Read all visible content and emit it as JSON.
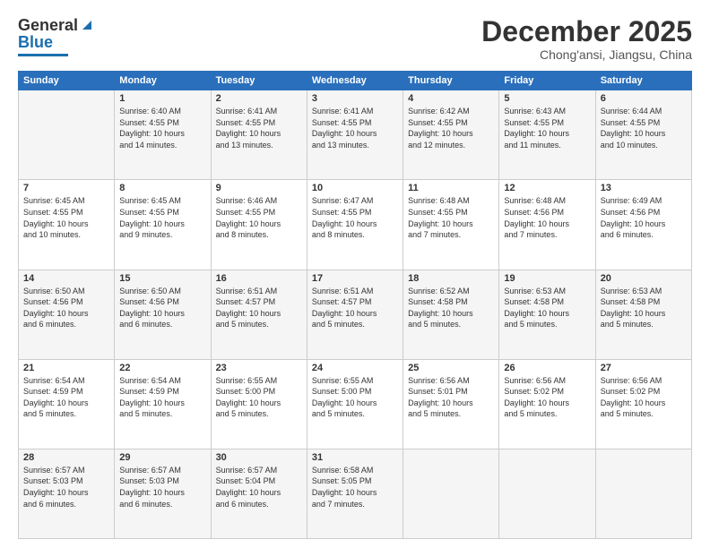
{
  "logo": {
    "line1": "General",
    "line2": "Blue"
  },
  "header": {
    "title": "December 2025",
    "subtitle": "Chong'ansi, Jiangsu, China"
  },
  "weekdays": [
    "Sunday",
    "Monday",
    "Tuesday",
    "Wednesday",
    "Thursday",
    "Friday",
    "Saturday"
  ],
  "weeks": [
    [
      {
        "day": "",
        "info": ""
      },
      {
        "day": "1",
        "info": "Sunrise: 6:40 AM\nSunset: 4:55 PM\nDaylight: 10 hours\nand 14 minutes."
      },
      {
        "day": "2",
        "info": "Sunrise: 6:41 AM\nSunset: 4:55 PM\nDaylight: 10 hours\nand 13 minutes."
      },
      {
        "day": "3",
        "info": "Sunrise: 6:41 AM\nSunset: 4:55 PM\nDaylight: 10 hours\nand 13 minutes."
      },
      {
        "day": "4",
        "info": "Sunrise: 6:42 AM\nSunset: 4:55 PM\nDaylight: 10 hours\nand 12 minutes."
      },
      {
        "day": "5",
        "info": "Sunrise: 6:43 AM\nSunset: 4:55 PM\nDaylight: 10 hours\nand 11 minutes."
      },
      {
        "day": "6",
        "info": "Sunrise: 6:44 AM\nSunset: 4:55 PM\nDaylight: 10 hours\nand 10 minutes."
      }
    ],
    [
      {
        "day": "7",
        "info": "Sunrise: 6:45 AM\nSunset: 4:55 PM\nDaylight: 10 hours\nand 10 minutes."
      },
      {
        "day": "8",
        "info": "Sunrise: 6:45 AM\nSunset: 4:55 PM\nDaylight: 10 hours\nand 9 minutes."
      },
      {
        "day": "9",
        "info": "Sunrise: 6:46 AM\nSunset: 4:55 PM\nDaylight: 10 hours\nand 8 minutes."
      },
      {
        "day": "10",
        "info": "Sunrise: 6:47 AM\nSunset: 4:55 PM\nDaylight: 10 hours\nand 8 minutes."
      },
      {
        "day": "11",
        "info": "Sunrise: 6:48 AM\nSunset: 4:55 PM\nDaylight: 10 hours\nand 7 minutes."
      },
      {
        "day": "12",
        "info": "Sunrise: 6:48 AM\nSunset: 4:56 PM\nDaylight: 10 hours\nand 7 minutes."
      },
      {
        "day": "13",
        "info": "Sunrise: 6:49 AM\nSunset: 4:56 PM\nDaylight: 10 hours\nand 6 minutes."
      }
    ],
    [
      {
        "day": "14",
        "info": "Sunrise: 6:50 AM\nSunset: 4:56 PM\nDaylight: 10 hours\nand 6 minutes."
      },
      {
        "day": "15",
        "info": "Sunrise: 6:50 AM\nSunset: 4:56 PM\nDaylight: 10 hours\nand 6 minutes."
      },
      {
        "day": "16",
        "info": "Sunrise: 6:51 AM\nSunset: 4:57 PM\nDaylight: 10 hours\nand 5 minutes."
      },
      {
        "day": "17",
        "info": "Sunrise: 6:51 AM\nSunset: 4:57 PM\nDaylight: 10 hours\nand 5 minutes."
      },
      {
        "day": "18",
        "info": "Sunrise: 6:52 AM\nSunset: 4:58 PM\nDaylight: 10 hours\nand 5 minutes."
      },
      {
        "day": "19",
        "info": "Sunrise: 6:53 AM\nSunset: 4:58 PM\nDaylight: 10 hours\nand 5 minutes."
      },
      {
        "day": "20",
        "info": "Sunrise: 6:53 AM\nSunset: 4:58 PM\nDaylight: 10 hours\nand 5 minutes."
      }
    ],
    [
      {
        "day": "21",
        "info": "Sunrise: 6:54 AM\nSunset: 4:59 PM\nDaylight: 10 hours\nand 5 minutes."
      },
      {
        "day": "22",
        "info": "Sunrise: 6:54 AM\nSunset: 4:59 PM\nDaylight: 10 hours\nand 5 minutes."
      },
      {
        "day": "23",
        "info": "Sunrise: 6:55 AM\nSunset: 5:00 PM\nDaylight: 10 hours\nand 5 minutes."
      },
      {
        "day": "24",
        "info": "Sunrise: 6:55 AM\nSunset: 5:00 PM\nDaylight: 10 hours\nand 5 minutes."
      },
      {
        "day": "25",
        "info": "Sunrise: 6:56 AM\nSunset: 5:01 PM\nDaylight: 10 hours\nand 5 minutes."
      },
      {
        "day": "26",
        "info": "Sunrise: 6:56 AM\nSunset: 5:02 PM\nDaylight: 10 hours\nand 5 minutes."
      },
      {
        "day": "27",
        "info": "Sunrise: 6:56 AM\nSunset: 5:02 PM\nDaylight: 10 hours\nand 5 minutes."
      }
    ],
    [
      {
        "day": "28",
        "info": "Sunrise: 6:57 AM\nSunset: 5:03 PM\nDaylight: 10 hours\nand 6 minutes."
      },
      {
        "day": "29",
        "info": "Sunrise: 6:57 AM\nSunset: 5:03 PM\nDaylight: 10 hours\nand 6 minutes."
      },
      {
        "day": "30",
        "info": "Sunrise: 6:57 AM\nSunset: 5:04 PM\nDaylight: 10 hours\nand 6 minutes."
      },
      {
        "day": "31",
        "info": "Sunrise: 6:58 AM\nSunset: 5:05 PM\nDaylight: 10 hours\nand 7 minutes."
      },
      {
        "day": "",
        "info": ""
      },
      {
        "day": "",
        "info": ""
      },
      {
        "day": "",
        "info": ""
      }
    ]
  ]
}
